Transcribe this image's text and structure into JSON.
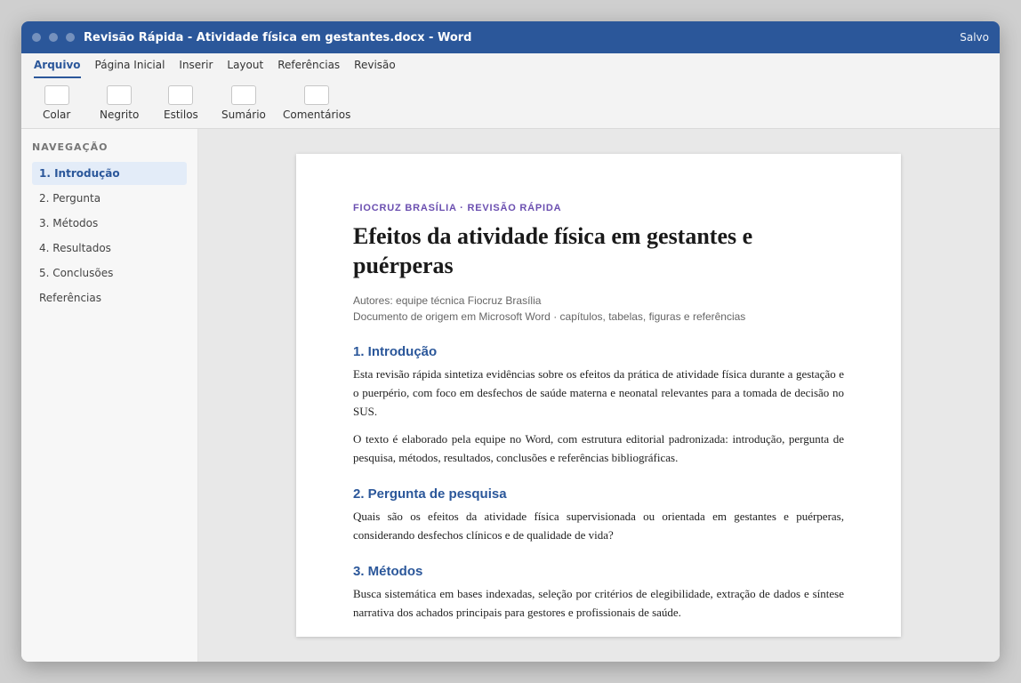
{
  "window": {
    "title": "Revisão Rápida - Atividade física em gestantes.docx - Word",
    "status": "Salvo"
  },
  "ribbon": {
    "tabs": [
      "Arquivo",
      "Página Inicial",
      "Inserir",
      "Layout",
      "Referências",
      "Revisão"
    ],
    "tools": [
      "Colar",
      "Negrito",
      "Estilos",
      "Sumário",
      "Comentários"
    ]
  },
  "sidebar": {
    "heading": "NAVEGAÇÃO",
    "items": [
      "1. Introdução",
      "2. Pergunta",
      "3. Métodos",
      "4. Resultados",
      "5. Conclusões",
      "Referências"
    ]
  },
  "document": {
    "kicker": "FIOCRUZ BRASÍLIA · REVISÃO RÁPIDA",
    "title": "Efeitos da atividade física em gestantes e puérperas",
    "authors": "Autores: equipe técnica Fiocruz Brasília",
    "origin": "Documento de origem em Microsoft Word · capítulos, tabelas, figuras e referências",
    "sections": [
      {
        "heading": "1. Introdução",
        "paragraphs": [
          "Esta revisão rápida sintetiza evidências sobre os efeitos da prática de atividade física durante a gestação e o puerpério, com foco em desfechos de saúde materna e neonatal relevantes para a tomada de decisão no SUS.",
          "O texto é elaborado pela equipe no Word, com estrutura editorial padronizada: introdução, pergunta de pesquisa, métodos, resultados, conclusões e referências bibliográficas."
        ]
      },
      {
        "heading": "2. Pergunta de pesquisa",
        "paragraphs": [
          "Quais são os efeitos da atividade física supervisionada ou orientada em gestantes e puérperas, considerando desfechos clínicos e de qualidade de vida?"
        ]
      },
      {
        "heading": "3. Métodos",
        "paragraphs": [
          "Busca sistemática em bases indexadas, seleção por critérios de elegibilidade, extração de dados e síntese narrativa dos achados principais para gestores e profissionais de saúde."
        ]
      }
    ]
  }
}
